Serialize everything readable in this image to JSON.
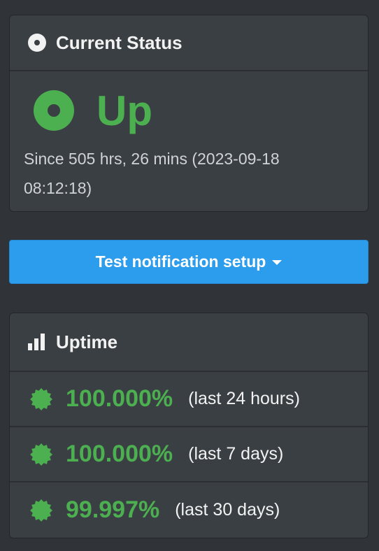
{
  "current_status": {
    "title": "Current Status",
    "status": "Up",
    "since_line1": "Since 505 hrs, 26 mins (2023-09-18",
    "since_line2": "08:12:18)",
    "status_color": "#4caf50"
  },
  "test_button": {
    "label": "Test notification setup"
  },
  "uptime": {
    "title": "Uptime",
    "rows": [
      {
        "percent": "100.000%",
        "period": "(last 24 hours)"
      },
      {
        "percent": "100.000%",
        "period": "(last 7 days)"
      },
      {
        "percent": "99.997%",
        "period": "(last 30 days)"
      }
    ]
  },
  "colors": {
    "background": "#303438",
    "card": "#3a3f43",
    "accent": "#2c9cec",
    "success": "#4caf50"
  }
}
